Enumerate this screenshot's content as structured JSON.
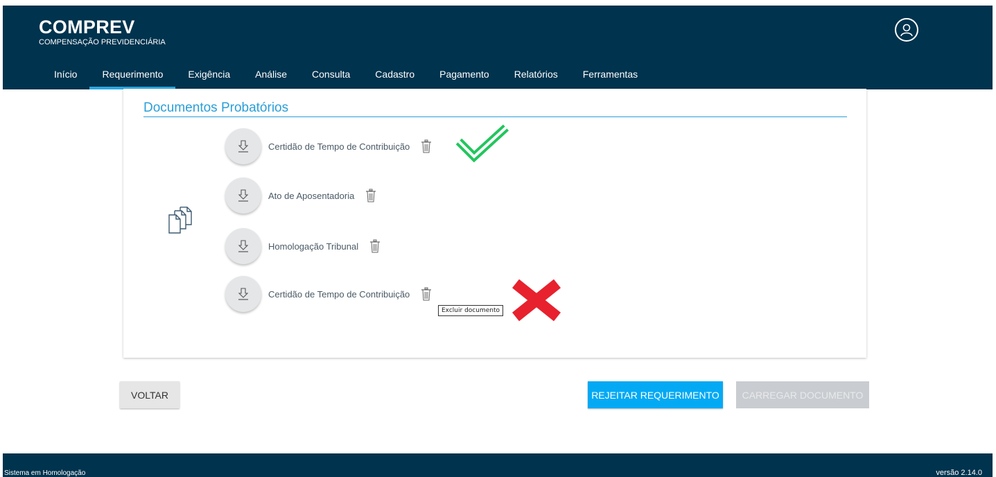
{
  "app": {
    "title": "COMPREV",
    "subtitle": "COMPENSAÇÃO PREVIDENCIÁRIA"
  },
  "nav": {
    "items": [
      {
        "label": "Início",
        "active": false
      },
      {
        "label": "Requerimento",
        "active": true
      },
      {
        "label": "Exigência",
        "active": false
      },
      {
        "label": "Análise",
        "active": false
      },
      {
        "label": "Consulta",
        "active": false
      },
      {
        "label": "Cadastro",
        "active": false
      },
      {
        "label": "Pagamento",
        "active": false
      },
      {
        "label": "Relatórios",
        "active": false
      },
      {
        "label": "Ferramentas",
        "active": false
      }
    ]
  },
  "section": {
    "title": "Documentos Probatórios"
  },
  "documents": [
    {
      "name": "Certidão de Tempo de Contribuição",
      "status": "approved"
    },
    {
      "name": "Ato de Aposentadoria",
      "status": "none"
    },
    {
      "name": "Homologação Tribunal",
      "status": "none"
    },
    {
      "name": "Certidão de Tempo de Contribuição",
      "status": "rejected"
    }
  ],
  "tooltip": {
    "text": "Excluir documento"
  },
  "buttons": {
    "voltar": "VOLTAR",
    "rejeitar": "REJEITAR REQUERIMENTO",
    "carregar": "CARREGAR DOCUMENTO"
  },
  "footer": {
    "left": "Sistema em Homologação",
    "right": "versão 2.14.0"
  },
  "colors": {
    "header_bg": "#00334e",
    "accent": "#2aa8e0",
    "primary_button": "#04a9f4",
    "approved_mark": "#22c55e",
    "rejected_mark": "#e8212e"
  },
  "icons": [
    "user-icon",
    "documents-icon",
    "download-icon",
    "trash-icon",
    "checkmark-icon",
    "cross-icon"
  ]
}
